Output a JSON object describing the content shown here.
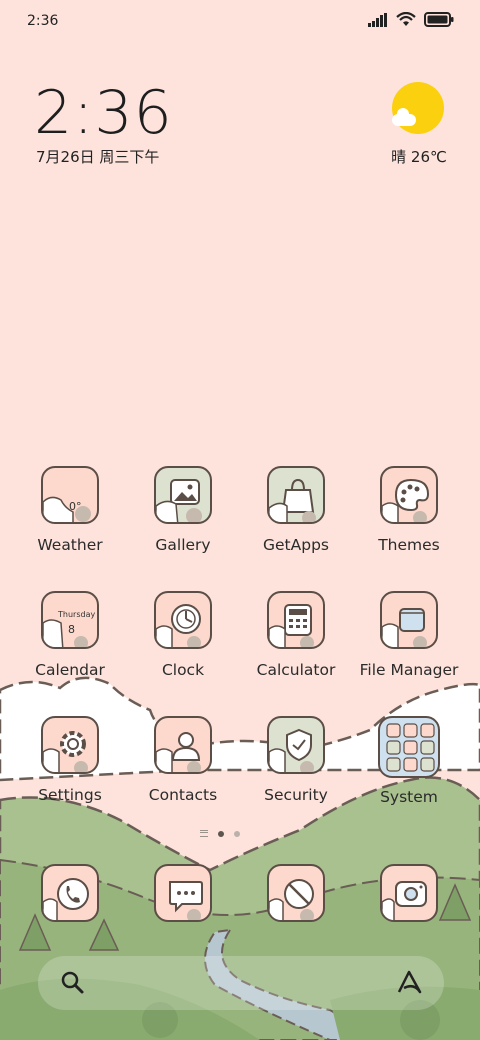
{
  "status_bar": {
    "time": "2:36",
    "signal_icon": "cellular-signal-icon",
    "wifi_icon": "wifi-icon",
    "battery_icon": "battery-icon"
  },
  "clock_widget": {
    "time": "2:36",
    "date": "7月26日 周三下午"
  },
  "weather_widget": {
    "icon": "sun-cloud-icon",
    "text": "晴 26℃"
  },
  "apps": [
    {
      "label": "Weather",
      "icon": "weather-icon"
    },
    {
      "label": "Gallery",
      "icon": "gallery-icon"
    },
    {
      "label": "GetApps",
      "icon": "shopping-bag-icon"
    },
    {
      "label": "Themes",
      "icon": "palette-icon"
    },
    {
      "label": "Calendar",
      "icon": "calendar-icon",
      "day": "8",
      "weekday": "Thursday"
    },
    {
      "label": "Clock",
      "icon": "clock-icon"
    },
    {
      "label": "Calculator",
      "icon": "calculator-icon"
    },
    {
      "label": "File Manager",
      "icon": "folder-icon"
    },
    {
      "label": "Settings",
      "icon": "gear-icon"
    },
    {
      "label": "Contacts",
      "icon": "contact-icon"
    },
    {
      "label": "Security",
      "icon": "shield-icon"
    },
    {
      "label": "System",
      "icon": "folder-grid-icon"
    }
  ],
  "weather_icon_text": "0°",
  "page_indicator": {
    "pages": 2,
    "current": 1
  },
  "dock": [
    {
      "icon": "phone-icon"
    },
    {
      "icon": "message-icon"
    },
    {
      "icon": "browser-icon"
    },
    {
      "icon": "camera-icon"
    }
  ],
  "search_bar": {
    "search_icon": "search-icon",
    "assistant_icon": "assistant-icon"
  },
  "colors": {
    "sky": "#fde3dc",
    "hill_green": "#a9c08f",
    "sun": "#fbd00f",
    "tile_pink": "#fdd8cc",
    "tile_green": "#dce2cf"
  }
}
